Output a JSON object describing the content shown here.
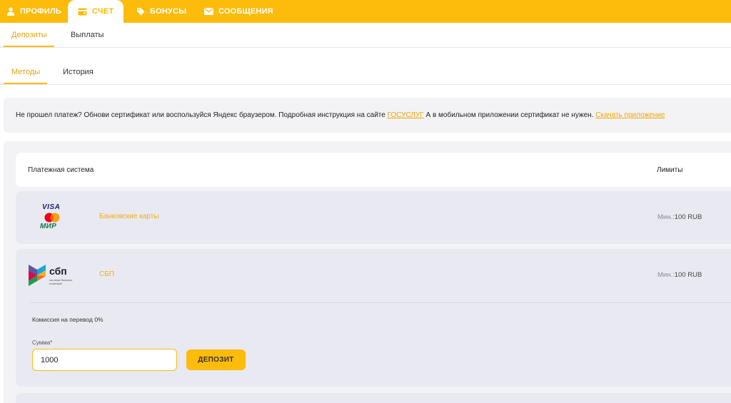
{
  "top_nav": {
    "tabs": [
      {
        "label": "ПРОФИЛЬ",
        "icon": "user-icon"
      },
      {
        "label": "СЧЕТ",
        "icon": "wallet-icon",
        "active": true
      },
      {
        "label": "БОНУСЫ",
        "icon": "tag-icon"
      },
      {
        "label": "СООБЩЕНИЯ",
        "icon": "envelope-icon"
      }
    ]
  },
  "account_tabs": [
    {
      "label": "Депозиты",
      "active": true
    },
    {
      "label": "Выплаты"
    }
  ],
  "deposit_tabs": [
    {
      "label": "Методы",
      "active": true
    },
    {
      "label": "История"
    }
  ],
  "notice": {
    "text_before": "Не прошел платеж? Обнови сертификат или воспользуйся Яндекс браузером. Подробная инструкция на сайте ",
    "link_gosuslugi": "ГОСУСЛУГ",
    "text_middle": " А в мобильном приложении сертификат не нужен. ",
    "link_app": "Скачать приложение"
  },
  "table": {
    "col_system": "Платежная система",
    "col_limits": "Лимиты"
  },
  "methods": [
    {
      "logo": {
        "line1": "VISA",
        "line3": "МИР"
      },
      "name": "Банковские карты",
      "limit_label": "Мин.:",
      "limit_value": "100 RUB"
    },
    {
      "logo": {
        "title": "сбп",
        "caption1": "система быстрых",
        "caption2": "платежей"
      },
      "name": "СБП",
      "limit_label": "Мин.:",
      "limit_value": "100 RUB",
      "commission": "Комиссия на перевод 0%",
      "amount_label": "Сумма*",
      "amount_value": "1000",
      "deposit_label": "ДЕПОЗИТ"
    }
  ],
  "colors": {
    "accent": "#fdbb0b",
    "link": "#f0a500",
    "panel_bg": "#f3f3f6",
    "row_bg": "#e9e9f1"
  }
}
